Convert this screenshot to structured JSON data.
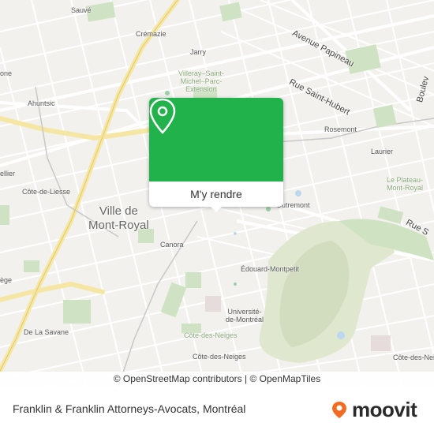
{
  "map": {
    "labels": {
      "sauve": "Sauvé",
      "cremazie": "Crémazie",
      "jarry": "Jarry",
      "villeray": "Villeray–Saint-\nMichel–Parc-\nExtension",
      "ahuntsic": "Ahuntsic",
      "rosemont": "Rosemont",
      "laurier": "Laurier",
      "plateau": "Le Plateau-\nMont-Royal",
      "outremont": "Outremont",
      "cote_de_liesse": "Côte-de-Liesse",
      "mont_royal": "Ville de\nMont-Royal",
      "canora": "Canora",
      "edouard": "Édouard-Montpetit",
      "universite": "Université-\nde-Montréal",
      "cdn_green": "Côte-des-Neiges",
      "cdn": "Côte-des-Neiges",
      "de_la_savane": "De La Savane",
      "ellier": "ellier",
      "ege": "ège",
      "one": "one",
      "cote_des_neiges_s": "Côte-des-Neiges"
    },
    "streets": {
      "papineau": "Avenue Papineau",
      "st_hubert": "Rue Saint-Hubert",
      "boulevard": "Boulev",
      "rue_s": "Rue S"
    }
  },
  "popup": {
    "button_label": "M'y rendre",
    "pin_color": "#22b24c"
  },
  "attribution": "© OpenStreetMap contributors | © OpenMapTiles",
  "footer": {
    "place_title": "Franklin & Franklin Attorneys-Avocats, Montréal",
    "brand": "moovit",
    "brand_color": "#f26b21"
  }
}
